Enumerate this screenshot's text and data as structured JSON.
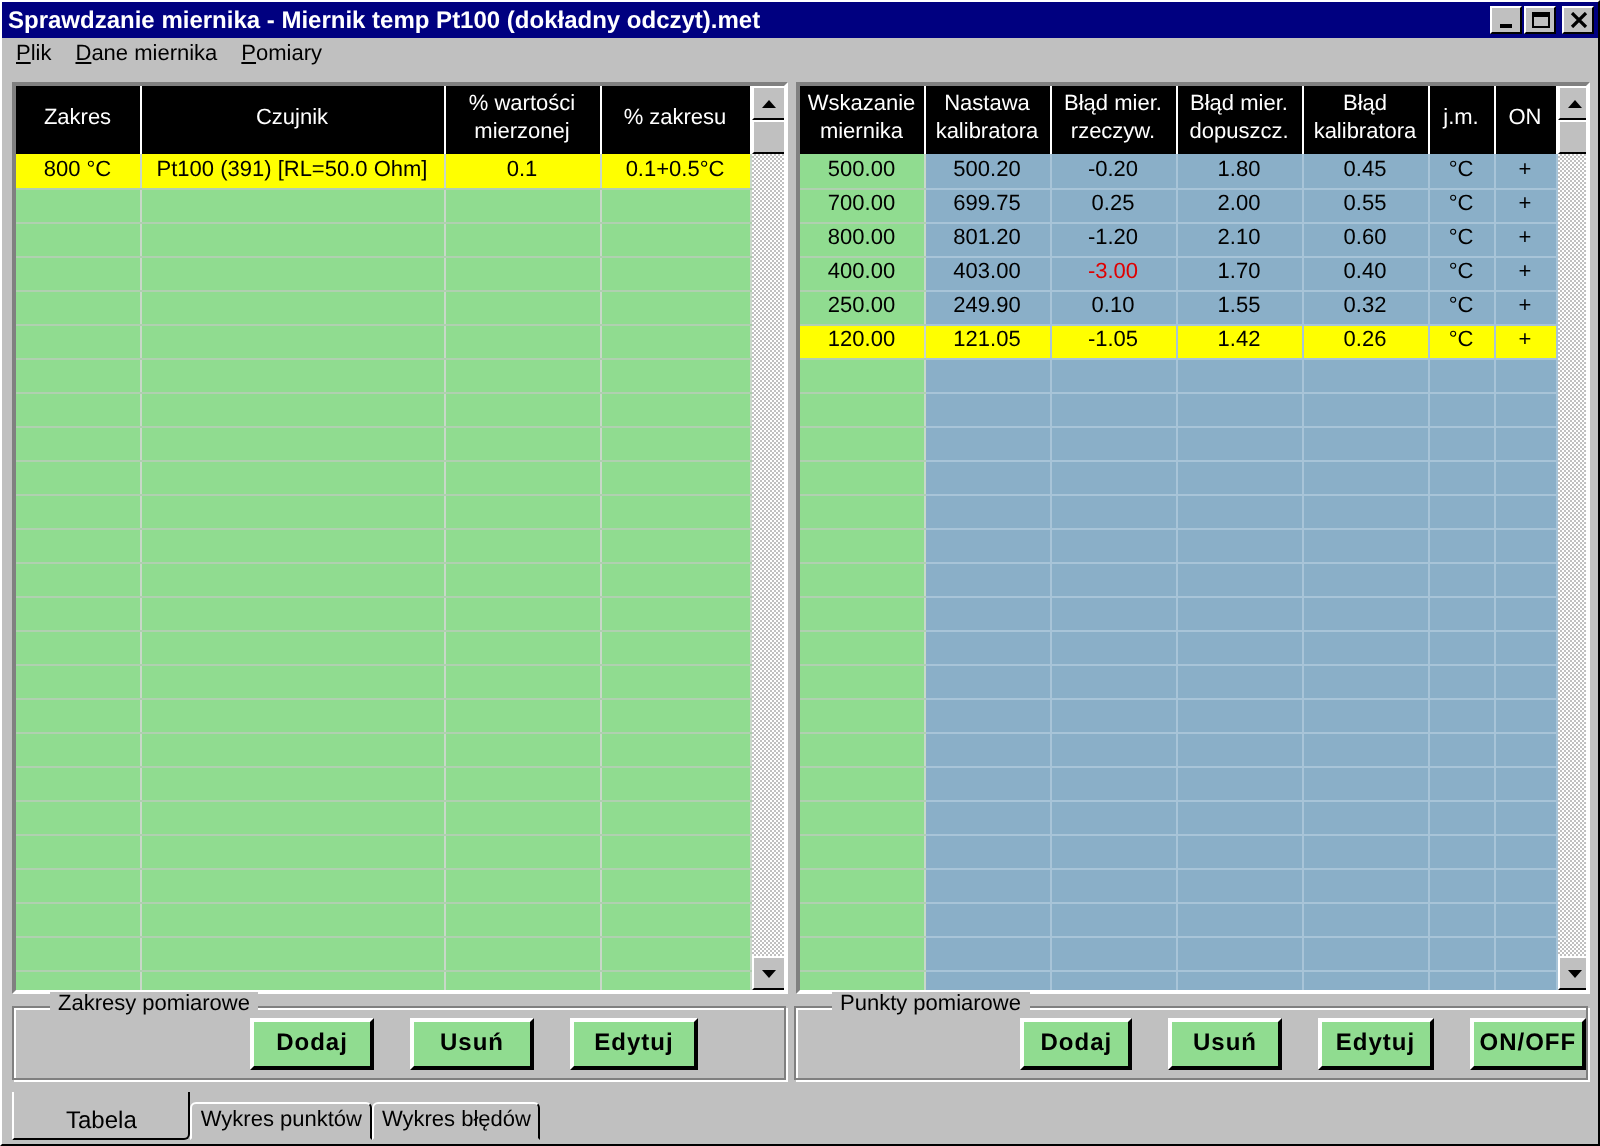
{
  "window": {
    "title": "Sprawdzanie miernika - Miernik temp Pt100 (dokładny odczyt).met"
  },
  "menu": [
    {
      "accel": "P",
      "rest": "lik"
    },
    {
      "accel": "D",
      "rest": "ane miernika"
    },
    {
      "accel": "P",
      "rest": "omiary"
    }
  ],
  "ranges_table": {
    "columns": [
      "Zakres",
      "Czujnik",
      "% wartości mierzonej",
      "% zakresu"
    ],
    "rows": [
      {
        "cells": [
          "800 °C",
          "Pt100 (391) [RL=50.0 Ohm]",
          "0.1",
          "0.1+0.5°C"
        ],
        "selected": true
      }
    ]
  },
  "points_table": {
    "columns": [
      "Wskazanie miernika",
      "Nastawa kalibratora",
      "Błąd mier. rzeczyw.",
      "Błąd mier. dopuszcz.",
      "Błąd kalibratora",
      "j.m.",
      "ON"
    ],
    "rows": [
      {
        "cells": [
          "500.00",
          "500.20",
          "-0.20",
          "1.80",
          "0.45",
          "°C",
          "+"
        ],
        "selected": false,
        "exceeded": false
      },
      {
        "cells": [
          "700.00",
          "699.75",
          "0.25",
          "2.00",
          "0.55",
          "°C",
          "+"
        ],
        "selected": false,
        "exceeded": false
      },
      {
        "cells": [
          "800.00",
          "801.20",
          "-1.20",
          "2.10",
          "0.60",
          "°C",
          "+"
        ],
        "selected": false,
        "exceeded": false
      },
      {
        "cells": [
          "400.00",
          "403.00",
          "-3.00",
          "1.70",
          "0.40",
          "°C",
          "+"
        ],
        "selected": false,
        "exceeded": true
      },
      {
        "cells": [
          "250.00",
          "249.90",
          "0.10",
          "1.55",
          "0.32",
          "°C",
          "+"
        ],
        "selected": false,
        "exceeded": false
      },
      {
        "cells": [
          "120.00",
          "121.05",
          "-1.05",
          "1.42",
          "0.26",
          "°C",
          "+"
        ],
        "selected": true,
        "exceeded": false
      }
    ]
  },
  "ranges_group": {
    "title": "Zakresy pomiarowe",
    "buttons": [
      "Dodaj",
      "Usuń",
      "Edytuj"
    ]
  },
  "points_group": {
    "title": "Punkty pomiarowe",
    "buttons": [
      "Dodaj",
      "Usuń",
      "Edytuj",
      "ON/OFF"
    ]
  },
  "tabs": [
    {
      "label": "Tabela",
      "selected": true
    },
    {
      "label": "Wykres punktów",
      "selected": false
    },
    {
      "label": "Wykres błędów",
      "selected": false
    }
  ]
}
